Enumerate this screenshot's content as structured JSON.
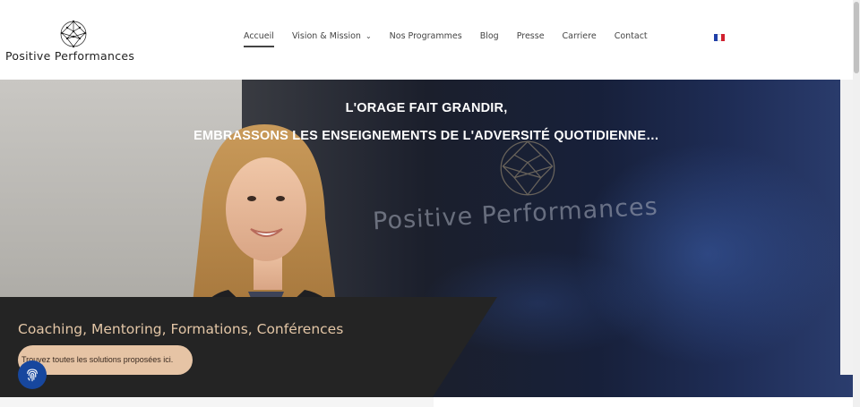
{
  "header": {
    "logo_text": "Positive Performances",
    "nav": [
      {
        "label": "Accueil",
        "active": true
      },
      {
        "label": "Vision & Mission",
        "has_dropdown": true
      },
      {
        "label": "Nos Programmes"
      },
      {
        "label": "Blog"
      },
      {
        "label": "Presse"
      },
      {
        "label": "Carriere"
      },
      {
        "label": "Contact"
      }
    ],
    "language_flag": "flag-fr-icon",
    "flag_colors": [
      "#1f3fa8",
      "#ffffff",
      "#d1202e"
    ]
  },
  "hero": {
    "title_line1": "L'ORAGE FAIT GRANDIR,",
    "title_line2": "EMBRASSONS LES ENSEIGNEMENTS DE L'ADVERSITÉ QUOTIDIENNE…",
    "background_brand_text": "Positive Performances"
  },
  "panel": {
    "title": "Coaching, Mentoring, Formations, Conférences",
    "cta_label": "Trouvez toutes les solutions proposées ici.",
    "accent_color": "#e6c4a5",
    "panel_color": "#242424"
  },
  "floating_button": {
    "icon": "fingerprint-icon",
    "color": "#17479e"
  }
}
